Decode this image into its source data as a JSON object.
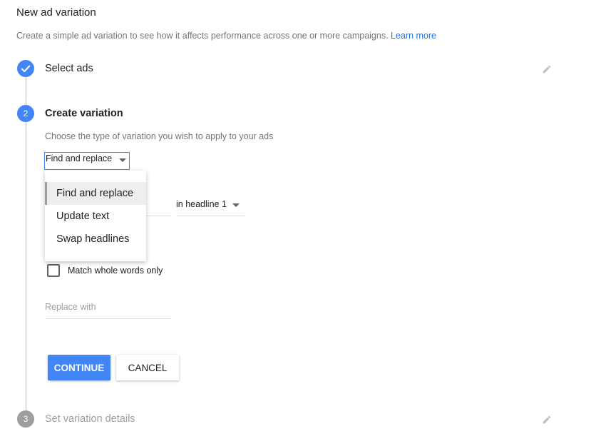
{
  "header": {
    "title": "New ad variation",
    "subtitle": "Create a simple ad variation to see how it affects performance across one or more campaigns.",
    "learn_more": "Learn more"
  },
  "steps": [
    {
      "label": "Select ads",
      "state": "completed",
      "icon": "check-icon"
    },
    {
      "label": "Create variation",
      "state": "active",
      "number": "2"
    },
    {
      "label": "Set variation details",
      "state": "pending",
      "number": "3"
    }
  ],
  "variation": {
    "instruction": "Choose the type of variation you wish to apply to your ads",
    "type_selected": "Find and replace",
    "menu_options": [
      "Find and replace",
      "Update text",
      "Swap headlines"
    ],
    "headline_selected": "in headline 1",
    "match_whole_words_label": "Match whole words only",
    "match_whole_words_checked": false,
    "replace_placeholder": "Replace with"
  },
  "buttons": {
    "continue": "CONTINUE",
    "cancel": "CANCEL"
  },
  "colors": {
    "accent": "#4285f4",
    "link": "#1a73e8",
    "muted": "#757575",
    "inactive": "#9e9e9e"
  }
}
